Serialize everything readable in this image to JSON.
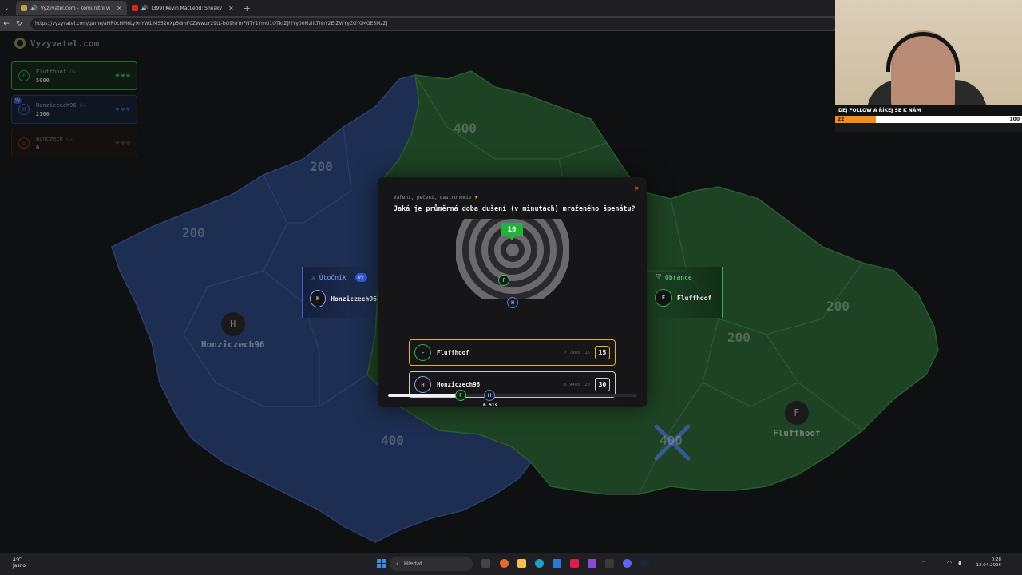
{
  "browser": {
    "tabs": [
      {
        "title": "Vyzyvatel.com - Komunitní ví",
        "active": true
      },
      {
        "title": "(399) Kevin MacLeod: Sneaky",
        "active": false
      }
    ],
    "url": "https://vyzyvatel.com/game/aHR0cHM6Ly9nYW1lMS52eXp5dmF0ZWwuY29tL-bG9hYmFNTY1YmU1OTktZjhlYy00MzliLThhY2EtZWYyZGY0MGE5MzZj"
  },
  "game": {
    "logo": "Vyzyvatel.com",
    "players": [
      {
        "initial": "F",
        "name": "Fluffhoof",
        "level": "0★",
        "score": "5000",
        "color": "#2fb54a",
        "hearts": [
          "♥",
          "♥",
          "♥"
        ]
      },
      {
        "initial": "H",
        "name": "Honziczech96",
        "level": "0★",
        "score": "2100",
        "color": "#3b63d6",
        "hearts": [
          "♥",
          "♥",
          "♥"
        ],
        "badge": "Vy"
      },
      {
        "initial": "B",
        "name": "Bonczech",
        "level": "0★",
        "score": "0",
        "color": "#c93030",
        "hearts": [
          "♥",
          "♥",
          "♥"
        ]
      }
    ],
    "regions": [
      "400",
      "200",
      "200",
      "400",
      "400",
      "200",
      "200"
    ],
    "bases": [
      {
        "initial": "H",
        "name": "Honziczech96"
      },
      {
        "initial": "F",
        "name": "Fluffhoof"
      }
    ],
    "attacker": {
      "label": "Útočník",
      "initial": "H",
      "name": "Honziczech96",
      "badge": "Vy"
    },
    "defender": {
      "label": "Obránce",
      "initial": "F",
      "name": "Fluffhoof"
    }
  },
  "question": {
    "category": "Vaření, pečení, gastronomie",
    "text": "Jaká je průměrná doba dušení (v minutách) mraženého špenátu?",
    "correct_answer": "10",
    "results": [
      {
        "initial": "F",
        "name": "Fluffhoof",
        "time": "7.798s",
        "guess": "15",
        "points": "15",
        "color": "#e6b31e"
      },
      {
        "initial": "H",
        "name": "Honziczech96",
        "time": "6.948s",
        "guess": "20",
        "points": "30",
        "color": "#c8ccd6"
      }
    ],
    "timer": {
      "value": "6.51s",
      "progress": 0.29
    }
  },
  "stream": {
    "banner": "DEJ FOLLOW A ŘÍKEJ SE K NÁM",
    "progress_label_left": "22",
    "progress_label_right": "100",
    "progress": 0.22
  },
  "taskbar": {
    "weather_temp": "4°C",
    "weather_desc": "Jasno",
    "search_placeholder": "Hledat",
    "time": "0:28",
    "date": "12.04.2026"
  }
}
